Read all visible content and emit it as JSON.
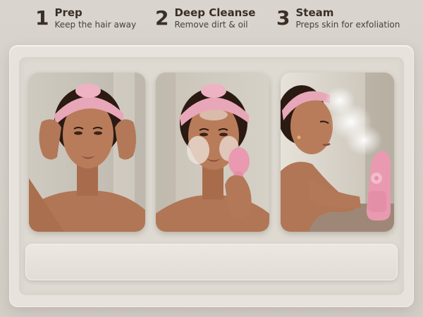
{
  "steps": [
    {
      "number": "1",
      "title": "Prep",
      "subtitle": "Keep the hair away"
    },
    {
      "number": "2",
      "title": "Deep Cleanse",
      "subtitle": "Remove dirt & oil"
    },
    {
      "number": "3",
      "title": "Steam",
      "subtitle": "Preps skin for exfoliation"
    }
  ],
  "photos": [
    {
      "subject": "woman adjusting pink headband"
    },
    {
      "subject": "woman cleansing face with pink silicone brush"
    },
    {
      "subject": "woman using pink facial steamer"
    }
  ],
  "colors": {
    "background": "#d9d5ce",
    "card": "#e7e3dc",
    "headband": "#e8a7b8",
    "device": "#e99ab0",
    "text": "#3a2f27"
  }
}
